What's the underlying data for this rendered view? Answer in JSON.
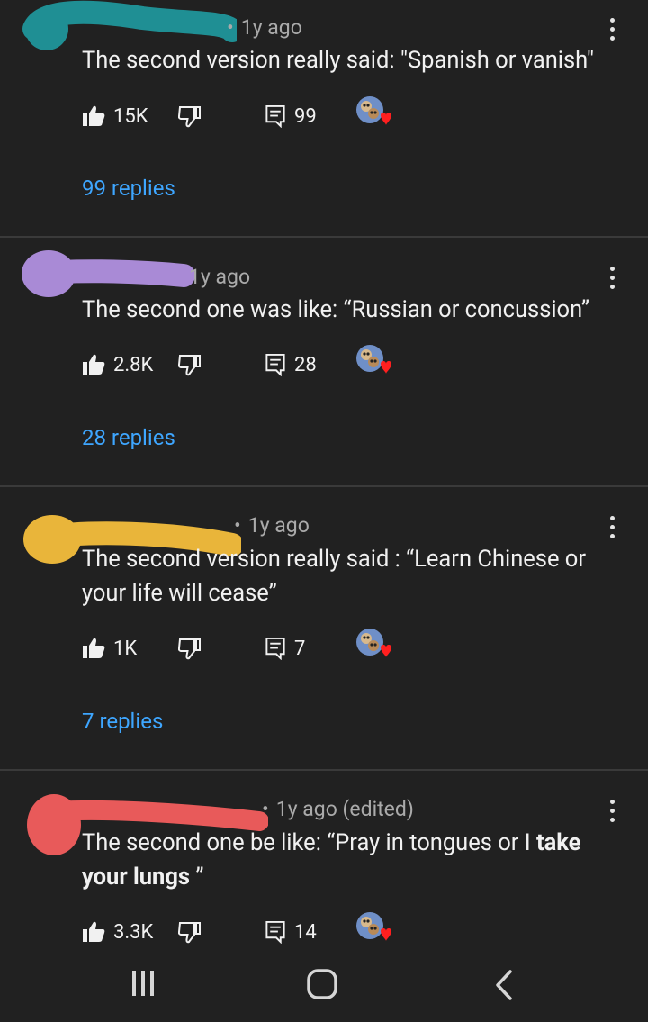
{
  "comments": [
    {
      "time": "1y ago",
      "text": "The second version really said: \"Spanish or vanish\"",
      "likes": "15K",
      "reply_count": "99",
      "replies_label": "99 replies",
      "scribble_color": "#1f8f94"
    },
    {
      "time": "1y ago",
      "text": "The second one was like: “Russian or concussion”",
      "likes": "2.8K",
      "reply_count": "28",
      "replies_label": "28 replies",
      "scribble_color": "#a98ad6"
    },
    {
      "time": "1y ago",
      "text_line1": "The second version really said : “Learn Chinese or",
      "text_line2": "your life will cease”",
      "likes": "1K",
      "reply_count": "7",
      "replies_label": "7 replies",
      "scribble_color": "#e9b53a"
    },
    {
      "time": "1y ago (edited)",
      "text_part1": "The second one be like: “Pray in tongues or I ",
      "text_bold1": "take",
      "text_bold2": "your lungs",
      "text_part2": " ”",
      "likes": "3.3K",
      "reply_count": "14",
      "scribble_color": "#e85a5a"
    }
  ],
  "icons": {
    "like": "thumbs-up-icon",
    "dislike": "thumbs-down-icon",
    "reply": "comment-icon",
    "more": "more-vert-icon",
    "heart": "creator-heart-icon"
  },
  "colors": {
    "background": "#212121",
    "link": "#3ea6ff",
    "heart": "#ff1f1f"
  }
}
